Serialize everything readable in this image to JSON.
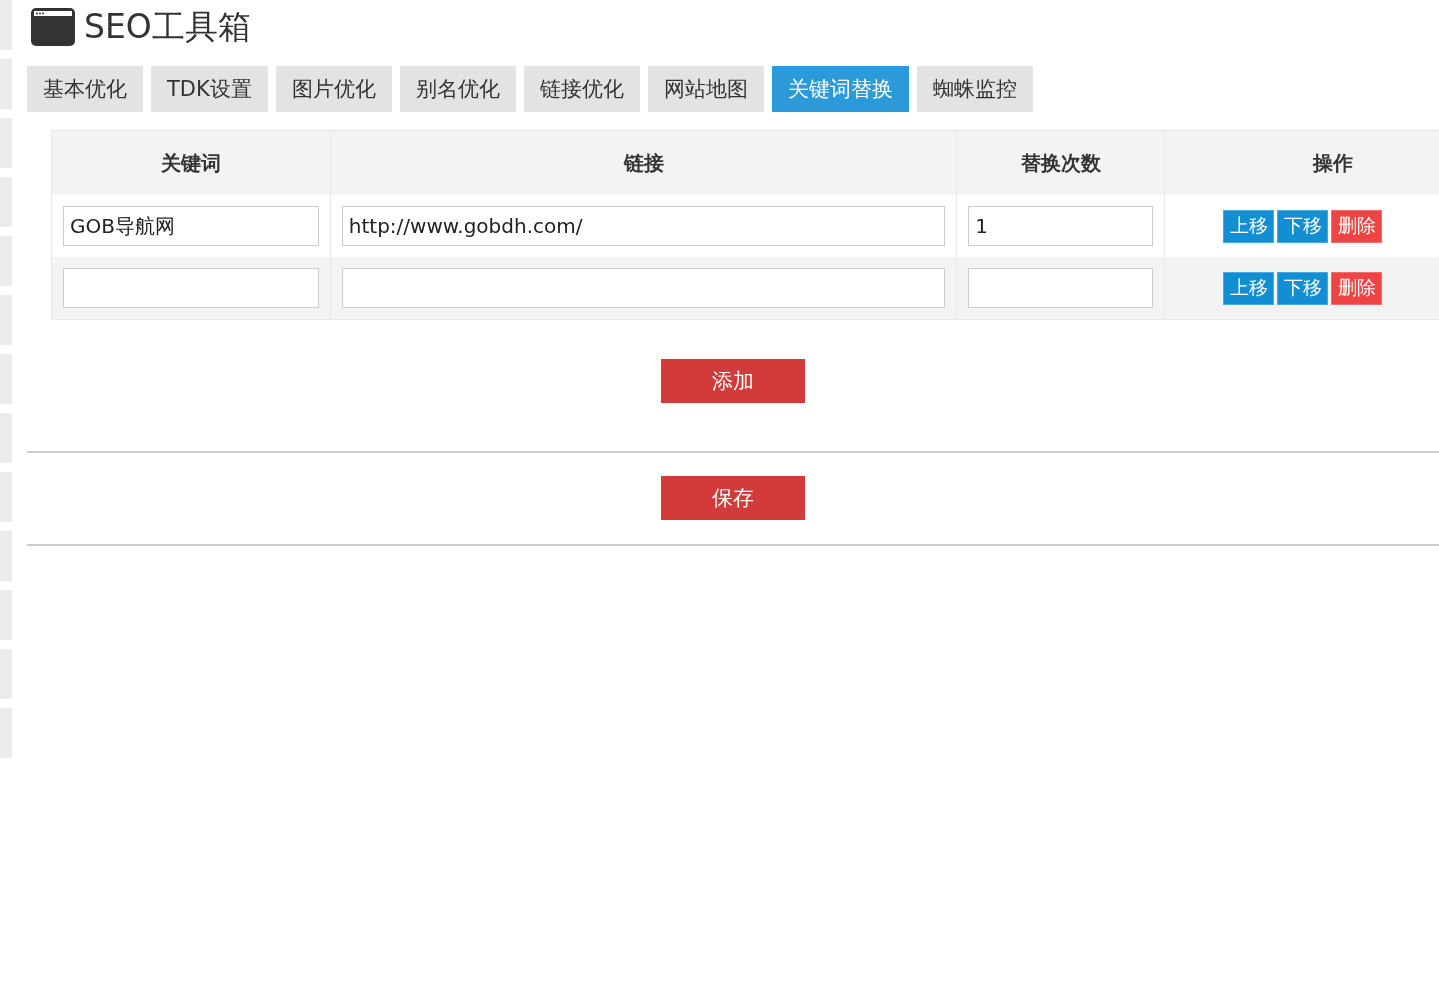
{
  "title": "SEO工具箱",
  "tabs": [
    {
      "label": "基本优化",
      "selected": false
    },
    {
      "label": "TDK设置",
      "selected": false
    },
    {
      "label": "图片优化",
      "selected": false
    },
    {
      "label": "别名优化",
      "selected": false
    },
    {
      "label": "链接优化",
      "selected": false
    },
    {
      "label": "网站地图",
      "selected": false
    },
    {
      "label": "关键词替换",
      "selected": true
    },
    {
      "label": "蜘蛛监控",
      "selected": false
    }
  ],
  "table": {
    "columns": [
      "关键词",
      "链接",
      "替换次数",
      "操作"
    ],
    "rows": [
      {
        "keyword": "GOB导航网",
        "link": "http://www.gobdh.com/",
        "count": "1",
        "actions": [
          {
            "label": "上移",
            "kind": "move"
          },
          {
            "label": "下移",
            "kind": "move"
          },
          {
            "label": "删除",
            "kind": "delete"
          }
        ]
      },
      {
        "keyword": "",
        "link": "",
        "count": "",
        "actions": [
          {
            "label": "上移",
            "kind": "move"
          },
          {
            "label": "下移",
            "kind": "move"
          },
          {
            "label": "删除",
            "kind": "delete"
          }
        ]
      }
    ]
  },
  "add_button": "添加",
  "save_button": "保存"
}
